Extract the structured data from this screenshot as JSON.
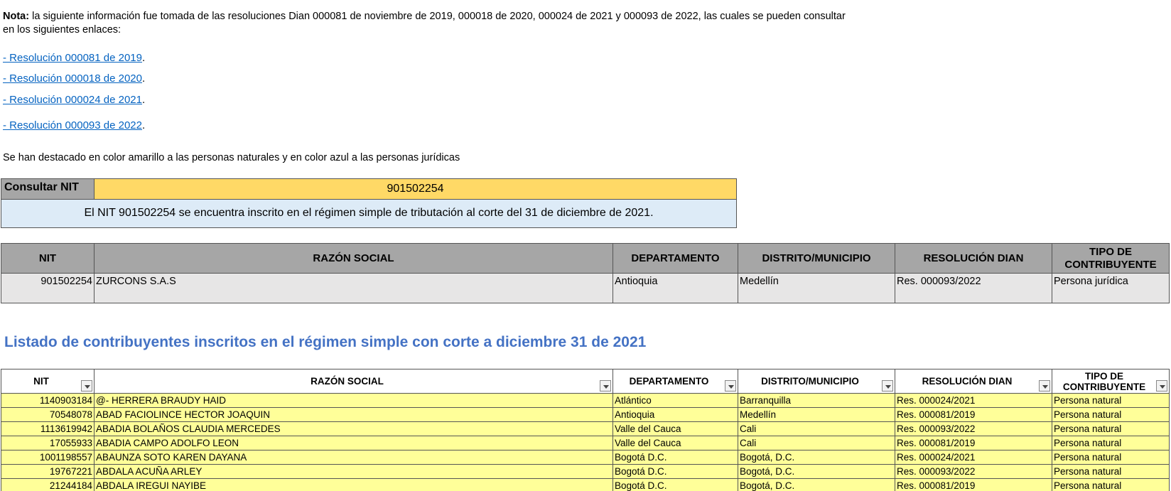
{
  "note": {
    "label": "Nota:",
    "text": " la siguiente información fue tomada de las resoluciones Dian 000081 de noviembre de 2019, 000018 de 2020, 000024 de 2021 y 000093 de 2022, las cuales se pueden consultar en los siguientes enlaces:"
  },
  "links": [
    {
      "text": " - Resolución 000081 de 2019",
      "dot": "."
    },
    {
      "text": " - Resolución 000018 de 2020",
      "dot": "."
    },
    {
      "text": " - Resolución 000024 de 2021",
      "dot": "."
    },
    {
      "text": " - Resolución 000093 de 2022",
      "dot": "."
    }
  ],
  "highlight_note": "Se han destacado en color amarillo a las personas naturales y en color azul a las personas jurídicas",
  "lookup": {
    "label": "Consultar NIT",
    "value": "901502254",
    "message": "El NIT 901502254 se encuentra inscrito en el régimen simple de tributación al corte del 31 de diciembre de 2021."
  },
  "columns": [
    "NIT",
    "RAZÓN SOCIAL",
    "DEPARTAMENTO",
    "DISTRITO/MUNICIPIO",
    "RESOLUCIÓN DIAN",
    "TIPO DE CONTRIBUYENTE"
  ],
  "result_row": [
    "901502254",
    "ZURCONS S.A.S",
    "Antioquia",
    "Medellín",
    "Res. 000093/2022",
    "Persona jurídica"
  ],
  "section_title": "Listado de contribuyentes inscritos en el régimen simple con corte a diciembre 31 de 2021",
  "rows": [
    [
      "1140903184",
      "@- HERRERA BRAUDY HAID",
      "Atlántico",
      "Barranquilla",
      "Res. 000024/2021",
      "Persona natural"
    ],
    [
      "70548078",
      "ABAD FACIOLINCE HECTOR JOAQUIN",
      "Antioquia",
      "Medellín",
      "Res. 000081/2019",
      "Persona natural"
    ],
    [
      "1113619942",
      "ABADIA BOLAÑOS CLAUDIA MERCEDES",
      "Valle del Cauca",
      "Cali",
      "Res. 000093/2022",
      "Persona natural"
    ],
    [
      "17055933",
      "ABADIA CAMPO ADOLFO LEON",
      "Valle del Cauca",
      "Cali",
      "Res. 000081/2019",
      "Persona natural"
    ],
    [
      "1001198557",
      "ABAUNZA SOTO KAREN DAYANA",
      "Bogotá D.C.",
      "Bogotá, D.C.",
      "Res. 000024/2021",
      "Persona natural"
    ],
    [
      "19767221",
      "ABDALA ACUÑA ARLEY",
      "Bogotá D.C.",
      "Bogotá, D.C.",
      "Res. 000093/2022",
      "Persona natural"
    ],
    [
      "21244184",
      "ABDALA IREGUI NAYIBE",
      "Bogotá D.C.",
      "Bogotá, D.C.",
      "Res. 000081/2019",
      "Persona natural"
    ],
    [
      "",
      "",
      "",
      "",
      "",
      ""
    ]
  ]
}
